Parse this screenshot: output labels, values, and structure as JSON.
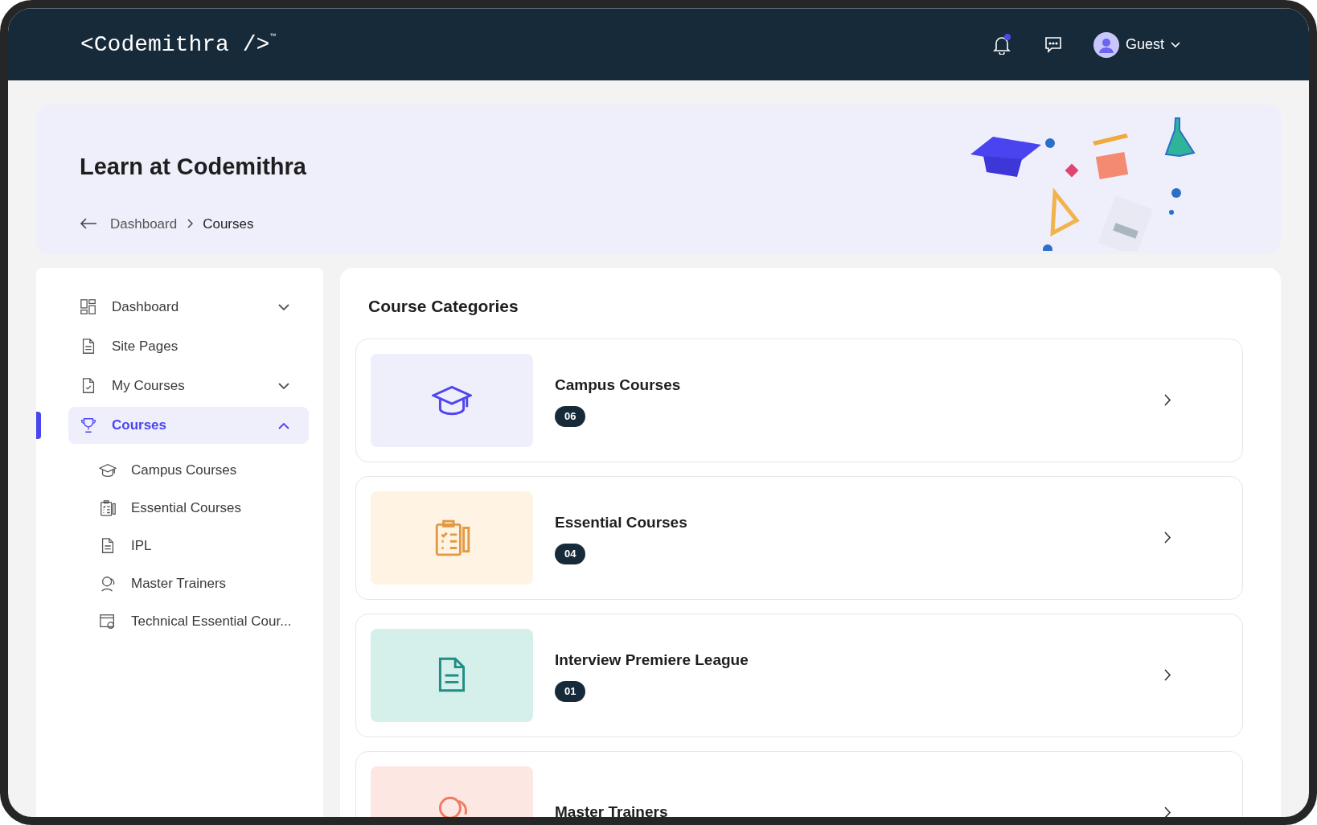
{
  "header": {
    "logo": "<Codemithra />",
    "logo_mark": "™",
    "unread": true,
    "user": "Guest"
  },
  "banner": {
    "title": "Learn at Codemithra",
    "breadcrumb": [
      {
        "label": "Dashboard",
        "current": false
      },
      {
        "label": "Courses",
        "current": true
      }
    ]
  },
  "sidebar": {
    "items": [
      {
        "label": "Dashboard",
        "kind": "dashboard",
        "expanded": false,
        "selected": false
      },
      {
        "label": "Site Pages",
        "kind": "page",
        "selected": false
      },
      {
        "label": "My Courses",
        "kind": "check-page",
        "expanded": false,
        "selected": false
      },
      {
        "label": "Courses",
        "kind": "trophy",
        "expanded": true,
        "selected": true,
        "children": [
          {
            "label": "Campus Courses",
            "kind": "cap",
            "selected": false
          },
          {
            "label": "Essential Courses",
            "kind": "clipboard",
            "selected": false
          },
          {
            "label": "IPL",
            "kind": "page",
            "selected": false
          },
          {
            "label": "Master Trainers",
            "kind": "people",
            "selected": false
          },
          {
            "label": "Technical Essential Cour...",
            "kind": "window-gear",
            "selected": false
          }
        ]
      }
    ]
  },
  "main": {
    "title": "Course Categories",
    "categories": [
      {
        "name": "Campus Courses",
        "count": "06",
        "kind": "cap",
        "color": "#5046f0"
      },
      {
        "name": "Essential Courses",
        "count": "04",
        "kind": "clipboard",
        "color": "#e39a45"
      },
      {
        "name": "Interview Premiere League",
        "count": "01",
        "kind": "page",
        "color": "#1f8c86"
      },
      {
        "name": "Master Trainers",
        "kind": "people",
        "color": "#f07a62"
      }
    ]
  }
}
